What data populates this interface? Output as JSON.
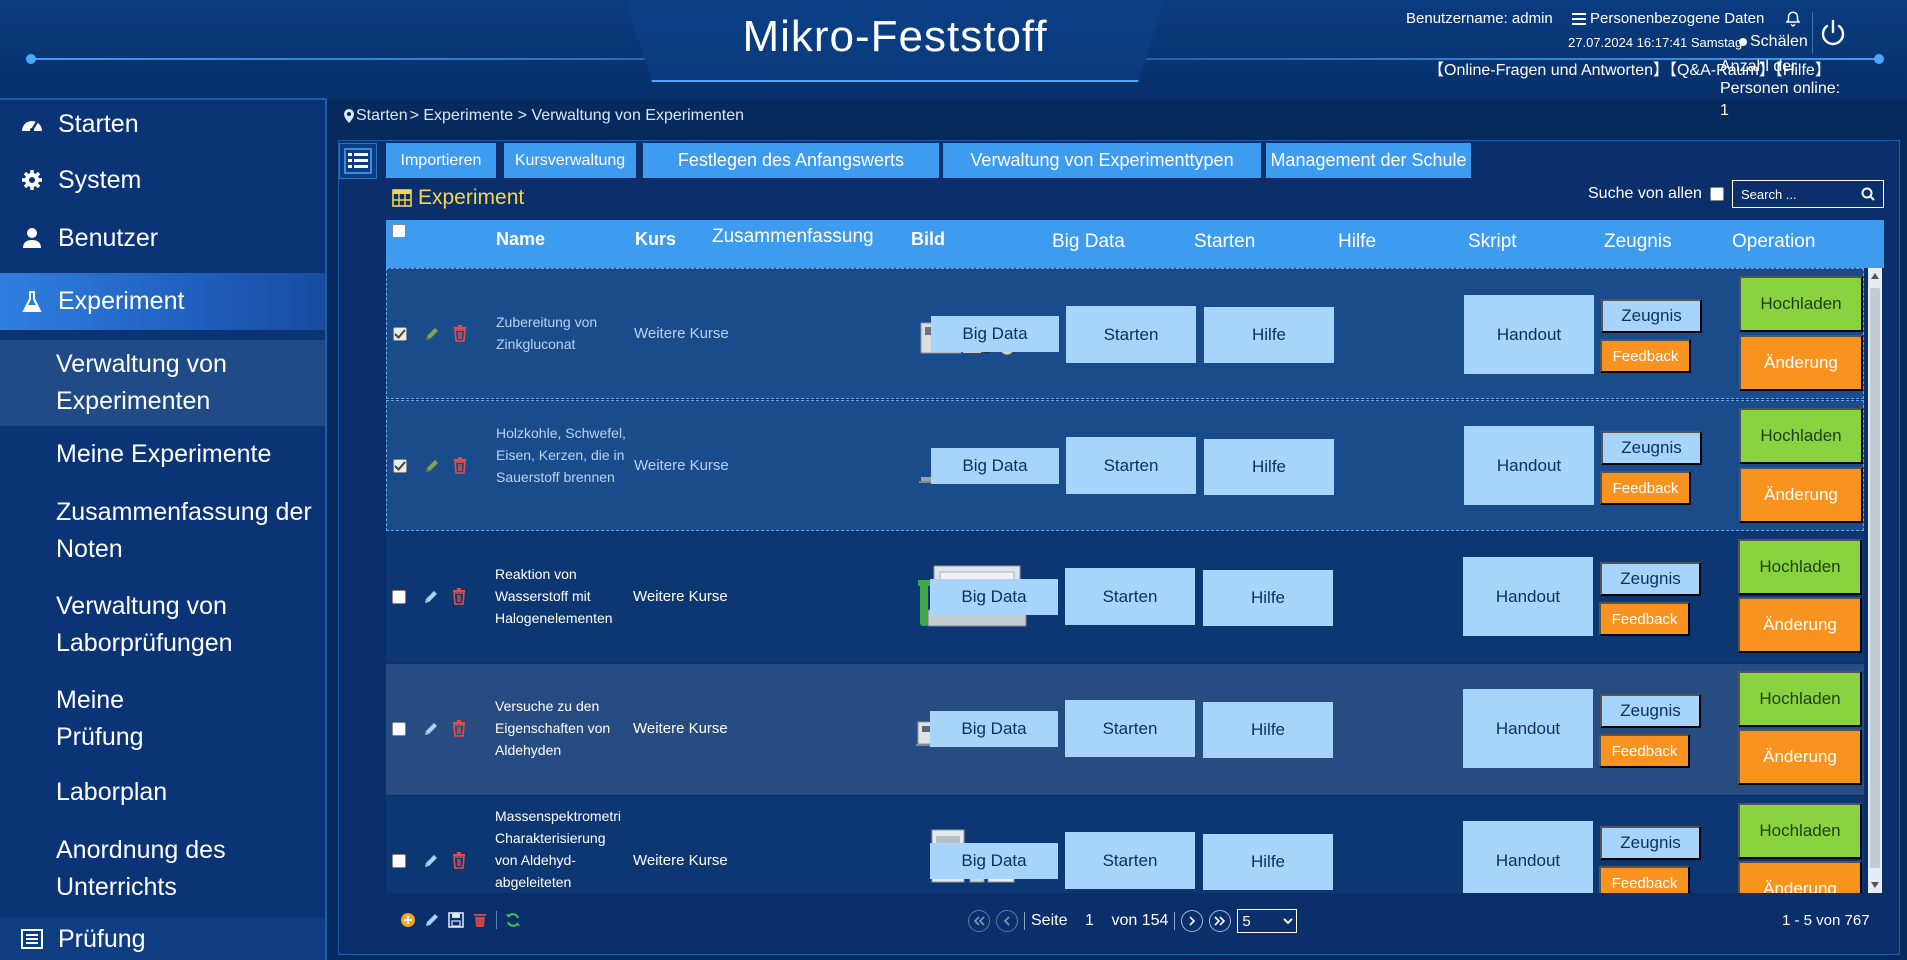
{
  "header": {
    "title": "Mikro-Feststoff",
    "username_label": "Benutzername: admin",
    "personal_data": "Personenbezogene Daten",
    "datetime": "27.07.2024 16:17:41 Samstag",
    "skin": "Schälen",
    "links": "【Online-Fragen und Antworten】【Q&A-Raum】【Hilfe】",
    "online_label": "Anzahl der Personen online:",
    "online_count": "1"
  },
  "sidebar": {
    "items": [
      {
        "label": "Starten",
        "icon": "dashboard-icon"
      },
      {
        "label": "System",
        "icon": "gear-icon"
      },
      {
        "label": "Benutzer",
        "icon": "user-icon"
      },
      {
        "label": "Experiment",
        "icon": "flask-icon",
        "active": true
      }
    ],
    "subitems": [
      {
        "label": "Verwaltung von Experimenten",
        "active": true
      },
      {
        "label": "Meine Experimente"
      },
      {
        "label": "Zusammenfassung der Noten"
      },
      {
        "label": "Verwaltung von Laborprüfungen"
      },
      {
        "label": "Meine Prüfung"
      },
      {
        "label": "Laborplan"
      },
      {
        "label": "Anordnung des Unterrichts"
      }
    ],
    "bottom_item": {
      "label": "Prüfung",
      "icon": "list-icon"
    }
  },
  "breadcrumb": {
    "home": "Starten",
    "trail": "> Experimente > Verwaltung von Experimenten"
  },
  "toolbar": {
    "import": "Importieren",
    "course_mgmt": "Kursverwaltung",
    "initial_value": "Festlegen des Anfangswerts",
    "exp_types": "Verwaltung von Experimenttypen",
    "school_mgmt": "Management der Schule"
  },
  "panel": {
    "title": "Experiment",
    "search_all": "Suche von allen",
    "search_placeholder": "Search ..."
  },
  "table": {
    "columns": {
      "name": "Name",
      "course": "Kurs",
      "summary": "Zusammenfassung",
      "image": "Bild",
      "bigdata": "Big Data",
      "start": "Starten",
      "help": "Hilfe",
      "script": "Skript",
      "certificate": "Zeugnis",
      "operation": "Operation"
    },
    "buttons": {
      "bigdata": "Big Data",
      "start": "Starten",
      "help": "Hilfe",
      "handout": "Handout",
      "certificate": "Zeugnis",
      "feedback": "Feedback",
      "upload": "Hochladen",
      "change": "Änderung"
    },
    "rows": [
      {
        "name": "Zubereitung von Zinkgluconat",
        "course": "Weitere Kurse",
        "checked": true
      },
      {
        "name": "Holzkohle, Schwefel, Eisen, Kerzen, die in Sauerstoff brennen",
        "course": "Weitere Kurse",
        "checked": true
      },
      {
        "name": "Reaktion von Wasserstoff mit Halogenelementen",
        "course": "Weitere Kurse",
        "checked": false
      },
      {
        "name": "Versuche zu den Eigenschaften von Aldehyden",
        "course": "Weitere Kurse",
        "checked": false
      },
      {
        "name": "Massenspektrometri Charakterisierung von Aldehyd-abgeleiteten",
        "course": "Weitere Kurse",
        "checked": false
      }
    ]
  },
  "pager": {
    "page_label": "Seite",
    "page": "1",
    "of_label": "von 154",
    "page_size": "5",
    "records": "1 - 5 von 767"
  },
  "colors": {
    "accent_blue": "#3d9bf0",
    "light_button": "#a6d4fb",
    "green": "#88d33f",
    "orange": "#f7931e",
    "title_yellow": "#f6d54a"
  }
}
